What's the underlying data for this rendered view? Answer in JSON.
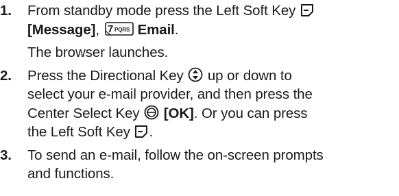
{
  "steps": [
    {
      "num": "1.",
      "seg1": "From standby mode press the Left Soft Key",
      "msg": "[Message]",
      "sep": ",",
      "key_label": "7PQRS",
      "email": "Email",
      "end": ".",
      "result": "The browser launches."
    },
    {
      "num": "2.",
      "seg1": "Press the Directional Key",
      "seg2": "up or down to",
      "line2": "select your e-mail provider, and then press the",
      "seg3": "Center Select Key",
      "ok": "[OK]",
      "seg4": ". Or you can press",
      "seg5": "the Left Soft Key",
      "end": "."
    },
    {
      "num": "3.",
      "line1": "To send an e-mail, follow the on-screen prompts",
      "line2": "and functions."
    }
  ]
}
